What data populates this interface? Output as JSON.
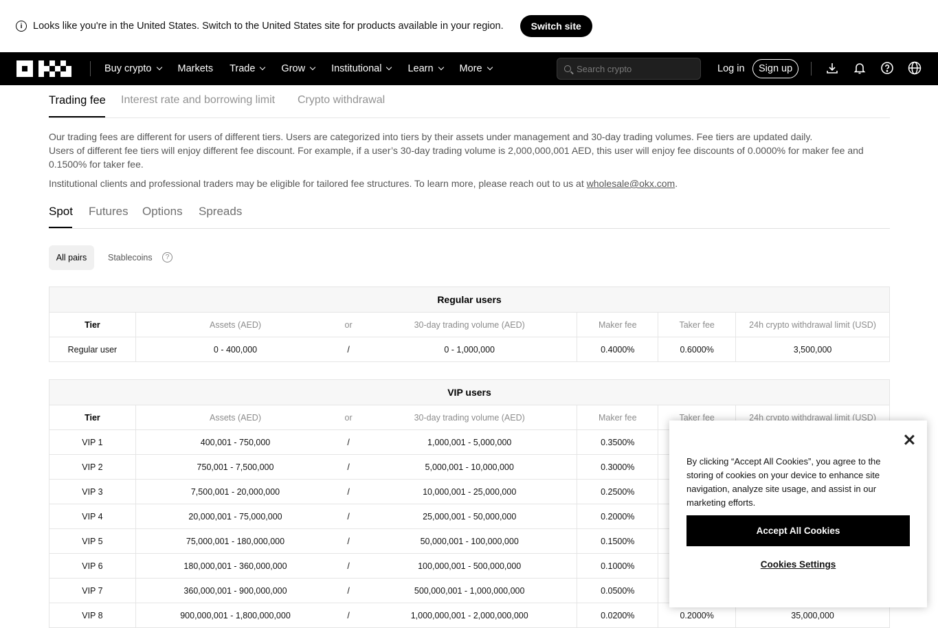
{
  "banner": {
    "message": "Looks like you're in the United States. Switch to the United States site for products available in your region.",
    "switch_label": "Switch site"
  },
  "nav": {
    "items": [
      {
        "label": "Buy crypto",
        "dropdown": true
      },
      {
        "label": "Markets",
        "dropdown": false
      },
      {
        "label": "Trade",
        "dropdown": true
      },
      {
        "label": "Grow",
        "dropdown": true
      },
      {
        "label": "Institutional",
        "dropdown": true
      },
      {
        "label": "Learn",
        "dropdown": true
      },
      {
        "label": "More",
        "dropdown": true
      }
    ],
    "search_placeholder": "Search crypto",
    "login": "Log in",
    "signup": "Sign up"
  },
  "tabs": {
    "trading_fee": "Trading fee",
    "interest": "Interest rate and borrowing limit",
    "withdrawal": "Crypto withdrawal"
  },
  "description": {
    "line1": "Our trading fees are different for users of different tiers. Users are categorized into tiers by their assets under management and 30-day trading volumes. Fee tiers are updated daily.",
    "line2": "Users of different fee tiers will enjoy different fee discount. For example, if a user’s 30-day trading volume is 2,000,000,001 AED, this user will enjoy fee discounts of 0.0000% for maker fee and 0.1500% for taker fee.",
    "line3_prefix": "Institutional clients and professional traders may be eligible for tailored fee structures. To learn more, please reach out to us at ",
    "email": "wholesale@okx.com",
    "line3_suffix": "."
  },
  "product_tabs": {
    "spot": "Spot",
    "futures": "Futures",
    "options": "Options",
    "spreads": "Spreads"
  },
  "filters": {
    "all_pairs": "All pairs",
    "stablecoins": "Stablecoins"
  },
  "columns": {
    "tier": "Tier",
    "assets": "Assets (AED)",
    "or": "or",
    "volume": "30-day trading volume (AED)",
    "maker": "Maker fee",
    "taker": "Taker fee",
    "limit": "24h crypto withdrawal limit (USD)"
  },
  "regular": {
    "caption": "Regular users",
    "rows": [
      {
        "tier": "Regular user",
        "assets": "0 - 400,000",
        "sep": "/",
        "volume": "0 - 1,000,000",
        "maker": "0.4000%",
        "taker": "0.6000%",
        "limit": "3,500,000"
      }
    ]
  },
  "vip": {
    "caption": "VIP users",
    "rows": [
      {
        "tier": "VIP 1",
        "assets": "400,001 - 750,000",
        "sep": "/",
        "volume": "1,000,001 - 5,000,000",
        "maker": "0.3500%",
        "taker": "",
        "limit": ""
      },
      {
        "tier": "VIP 2",
        "assets": "750,001 - 7,500,000",
        "sep": "/",
        "volume": "5,000,001 - 10,000,000",
        "maker": "0.3000%",
        "taker": "",
        "limit": ""
      },
      {
        "tier": "VIP 3",
        "assets": "7,500,001 - 20,000,000",
        "sep": "/",
        "volume": "10,000,001 - 25,000,000",
        "maker": "0.2500%",
        "taker": "",
        "limit": ""
      },
      {
        "tier": "VIP 4",
        "assets": "20,000,001 - 75,000,000",
        "sep": "/",
        "volume": "25,000,001 - 50,000,000",
        "maker": "0.2000%",
        "taker": "",
        "limit": ""
      },
      {
        "tier": "VIP 5",
        "assets": "75,000,001 - 180,000,000",
        "sep": "/",
        "volume": "50,000,001 - 100,000,000",
        "maker": "0.1500%",
        "taker": "",
        "limit": ""
      },
      {
        "tier": "VIP 6",
        "assets": "180,000,001 - 360,000,000",
        "sep": "/",
        "volume": "100,000,001 - 500,000,000",
        "maker": "0.1000%",
        "taker": "",
        "limit": ""
      },
      {
        "tier": "VIP 7",
        "assets": "360,000,001 - 900,000,000",
        "sep": "/",
        "volume": "500,000,001 - 1,000,000,000",
        "maker": "0.0500%",
        "taker": "",
        "limit": ""
      },
      {
        "tier": "VIP 8",
        "assets": "900,000,001 - 1,800,000,000",
        "sep": "/",
        "volume": "1,000,000,001 - 2,000,000,000",
        "maker": "0.0200%",
        "taker": "0.2000%",
        "limit": "35,000,000"
      }
    ]
  },
  "cookie": {
    "text": "By clicking “Accept All Cookies”, you agree to the storing of cookies on your device to enhance site navigation, analyze site usage, and assist in our marketing efforts.",
    "accept": "Accept All Cookies",
    "settings": "Cookies Settings"
  }
}
